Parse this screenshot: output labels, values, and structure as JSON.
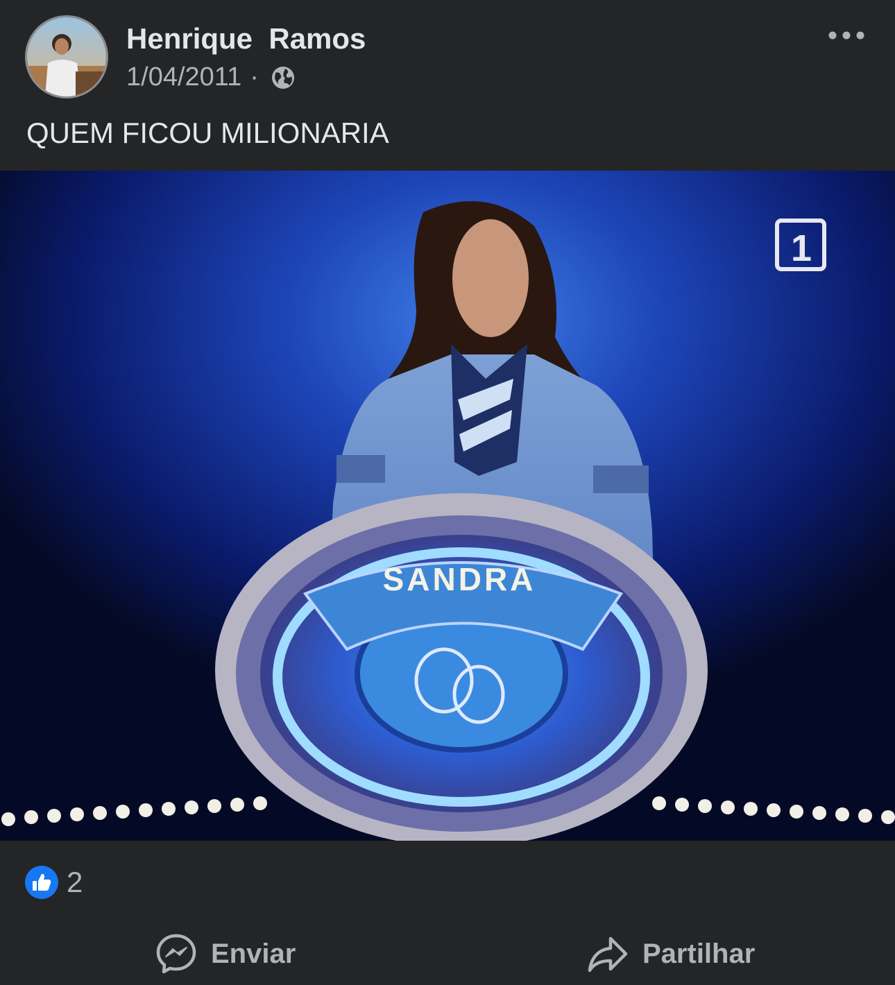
{
  "post": {
    "author": "Henrique  Ramos",
    "date": "1/04/2011",
    "separator": "·",
    "privacy_icon": "globe-icon",
    "text": "QUEM FICOU MILIONARIA"
  },
  "photo": {
    "podium_name": "SANDRA",
    "channel_logo": "1"
  },
  "reactions": {
    "icon": "like-icon",
    "count": "2"
  },
  "actions": {
    "send_label": "Enviar",
    "send_icon": "messenger-icon",
    "share_label": "Partilhar",
    "share_icon": "share-arrow-icon"
  },
  "colors": {
    "background": "#242526",
    "like_blue": "#1877f2",
    "text_primary": "#e4e6eb",
    "text_secondary": "#b0b3b8"
  }
}
